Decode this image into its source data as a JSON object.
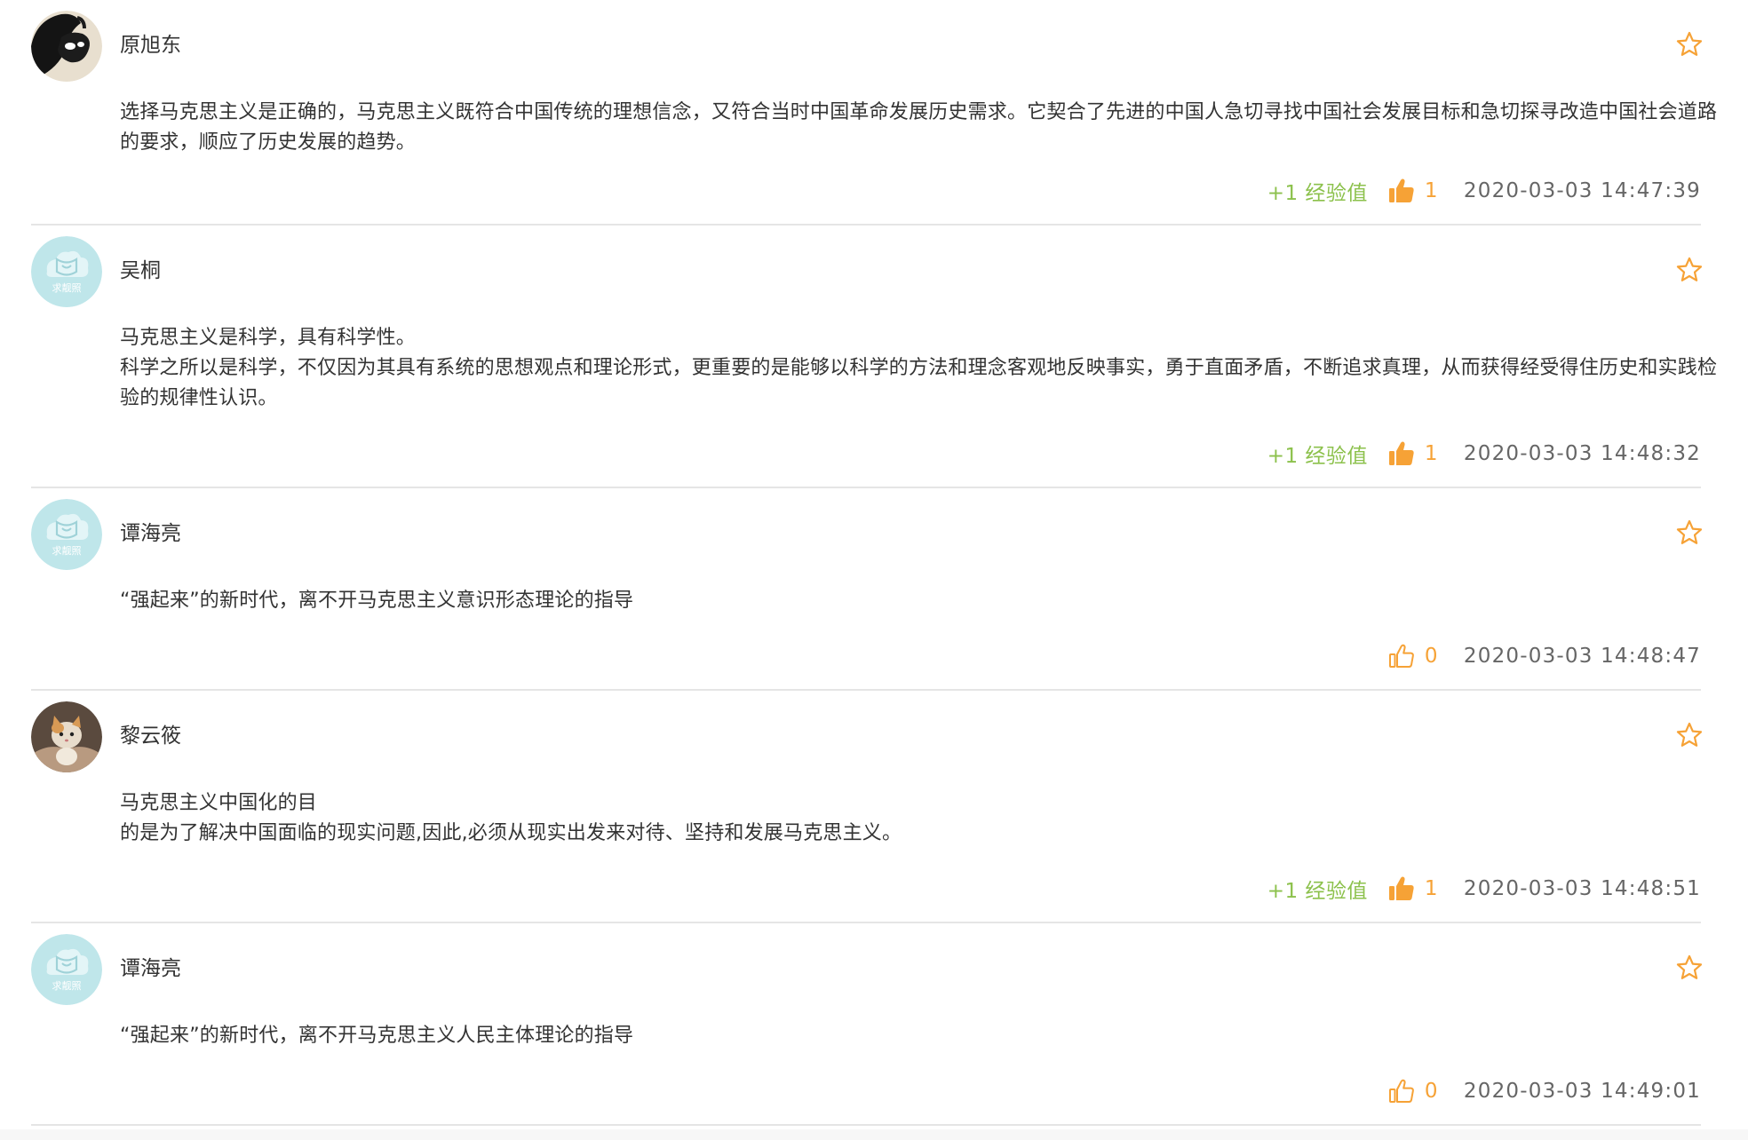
{
  "comments": [
    {
      "user": "原旭东",
      "avatar": "panda-mask-photo-avatar",
      "body": [
        "选择马克思主义是正确的，马克思主义既符合中国传统的理想信念，又符合当时中国革命发展历史需求。它契合了先进的中国人急切寻找中国社会发展目标和急切探寻改造中国社会道路的要求，顺应了历史发展的趋势。"
      ],
      "exp": "+1 经验值",
      "liked": true,
      "likes": "1",
      "time": "2020-03-03 14:47:39"
    },
    {
      "user": "吴桐",
      "avatar": "default-avatar",
      "avatar_text": "求靓照",
      "body": [
        "马克思主义是科学，具有科学性。",
        "科学之所以是科学，不仅因为其具有系统的思想观点和理论形式，更重要的是能够以科学的方法和理念客观地反映事实，勇于直面矛盾，不断追求真理，从而获得经受得住历史和实践检验的规律性认识。"
      ],
      "exp": "+1 经验值",
      "liked": true,
      "likes": "1",
      "time": "2020-03-03 14:48:32"
    },
    {
      "user": "谭海亮",
      "avatar": "default-avatar",
      "avatar_text": "求靓照",
      "body": [
        "“强起来”的新时代，离不开马克思主义意识形态理论的指导"
      ],
      "exp": "",
      "liked": false,
      "likes": "0",
      "time": "2020-03-03 14:48:47"
    },
    {
      "user": "黎云筱",
      "avatar": "cat-photo-avatar",
      "body": [
        "马克思主义中国化的目",
        "的是为了解决中国面临的现实问题,因此,必须从现实出发来对待、坚持和发展马克思主义。"
      ],
      "exp": "+1 经验值",
      "liked": true,
      "likes": "1",
      "time": "2020-03-03 14:48:51"
    },
    {
      "user": "谭海亮",
      "avatar": "default-avatar",
      "avatar_text": "求靓照",
      "body": [
        "“强起来”的新时代，离不开马克思主义人民主体理论的指导"
      ],
      "exp": "",
      "liked": false,
      "likes": "0",
      "time": "2020-03-03 14:49:01"
    }
  ],
  "colors": {
    "exp_green": "#8cc14c",
    "like_orange": "#f6a236",
    "text": "#333333",
    "divider": "#e5e5e5",
    "default_avatar_bg": "#bfe6ea"
  }
}
